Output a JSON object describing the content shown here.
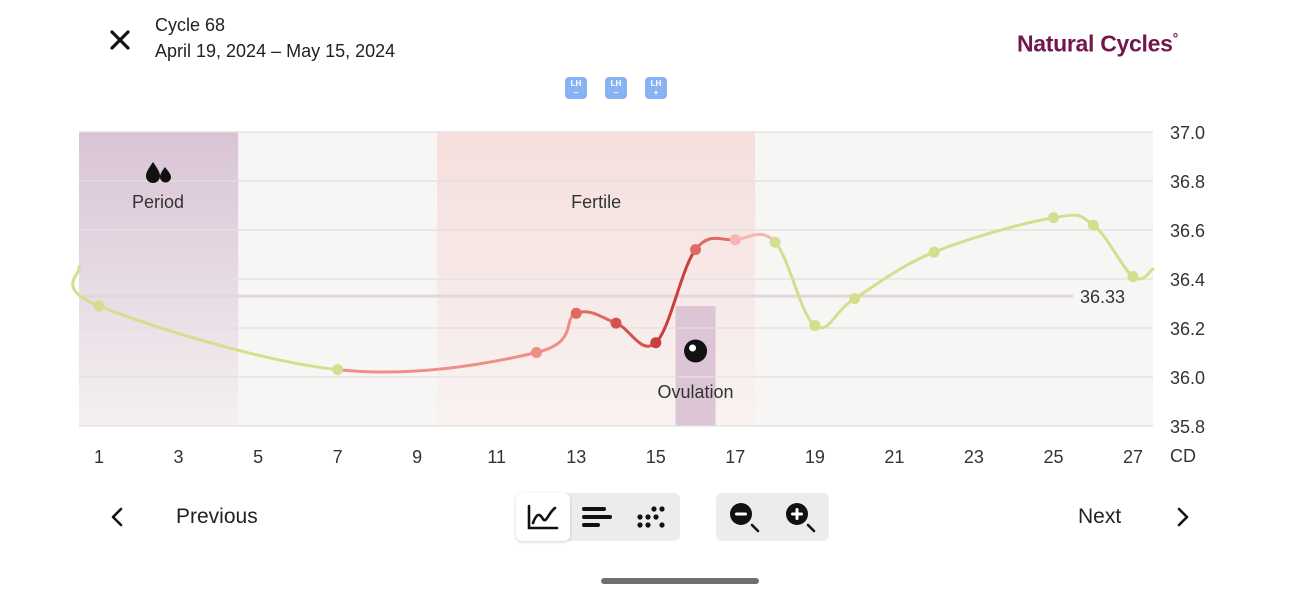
{
  "header": {
    "cycle_title": "Cycle 68",
    "cycle_dates": "April 19, 2024 – May 15, 2024",
    "brand": "Natural Cycles",
    "brand_mark": "°",
    "lh_badges": [
      {
        "top": "LH",
        "sign": "–"
      },
      {
        "top": "LH",
        "sign": "–"
      },
      {
        "top": "LH",
        "sign": "+"
      }
    ]
  },
  "chart_data": {
    "type": "line",
    "y_unit_ticks": [
      "37.0",
      "36.8",
      "36.6",
      "36.4",
      "36.2",
      "36.0",
      "35.8"
    ],
    "ylim": [
      35.8,
      37.0
    ],
    "x_ticks": [
      "1",
      "3",
      "5",
      "7",
      "9",
      "11",
      "13",
      "15",
      "17",
      "19",
      "21",
      "23",
      "25",
      "27"
    ],
    "x_unit_label": "CD",
    "xlim": [
      0.5,
      27.5
    ],
    "points": [
      {
        "cd": 1,
        "temp": 36.29,
        "color": "#d3df8f"
      },
      {
        "cd": 7,
        "temp": 36.03,
        "color": "#d3df8f"
      },
      {
        "cd": 12,
        "temp": 36.1,
        "color": "#f08d87"
      },
      {
        "cd": 13,
        "temp": 36.26,
        "color": "#e06962"
      },
      {
        "cd": 14,
        "temp": 36.22,
        "color": "#d6524e"
      },
      {
        "cd": 15,
        "temp": 36.14,
        "color": "#c7403f"
      },
      {
        "cd": 16,
        "temp": 36.52,
        "color": "#e06962"
      },
      {
        "cd": 17,
        "temp": 36.56,
        "color": "#f6b5b1"
      },
      {
        "cd": 18,
        "temp": 36.55,
        "color": "#d3df8f"
      },
      {
        "cd": 19,
        "temp": 36.21,
        "color": "#d3df8f"
      },
      {
        "cd": 20,
        "temp": 36.32,
        "color": "#d3df8f"
      },
      {
        "cd": 22,
        "temp": 36.51,
        "color": "#d3df8f"
      },
      {
        "cd": 25,
        "temp": 36.65,
        "color": "#d3df8f"
      },
      {
        "cd": 26,
        "temp": 36.62,
        "color": "#d3df8f"
      },
      {
        "cd": 27,
        "temp": 36.41,
        "color": "#d3df8f"
      }
    ],
    "coverline": {
      "value": 36.33,
      "label": "36.33"
    },
    "period": {
      "label": "Period",
      "from_cd": 0.5,
      "to_cd": 4.5
    },
    "fertile": {
      "label": "Fertile",
      "from_cd": 9.5,
      "to_cd": 17.5
    },
    "ovulation": {
      "label": "Ovulation",
      "cd": 16
    },
    "colors": {
      "luteal_green": "#d3df8f",
      "fertile_red": "#d6524e",
      "period_band": "#d9c4d6",
      "fertile_band": "#f6dfdd",
      "background": "#f8f6f5",
      "ovulation_band": "#dcc6d6"
    }
  },
  "footer": {
    "previous_label": "Previous",
    "next_label": "Next",
    "views": [
      {
        "icon": "line-chart-icon",
        "active": true
      },
      {
        "icon": "bars-icon",
        "active": false
      },
      {
        "icon": "dots-icon",
        "active": false
      }
    ],
    "zoom": [
      {
        "icon": "zoom-out-icon"
      },
      {
        "icon": "zoom-in-icon"
      }
    ]
  }
}
